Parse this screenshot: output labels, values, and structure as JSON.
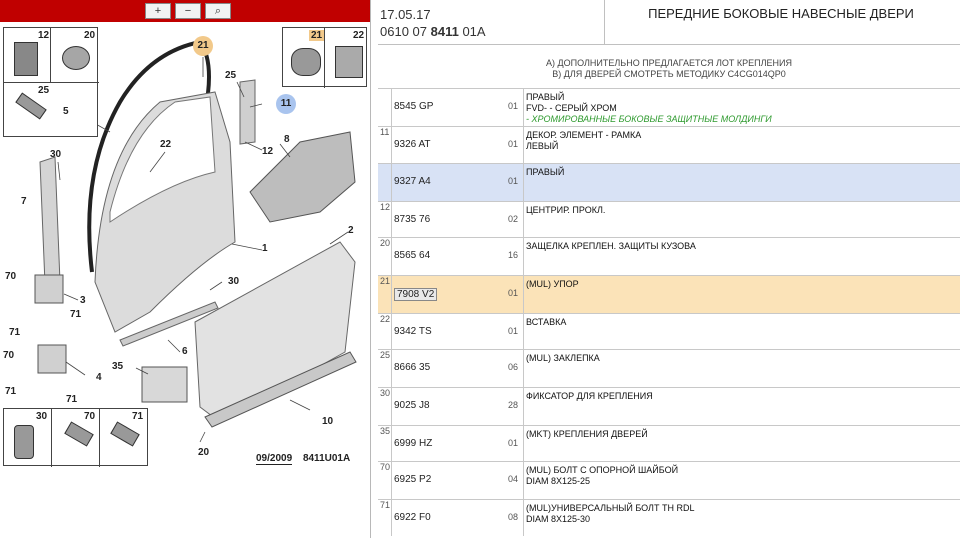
{
  "toolbar": {
    "zoom_in_label": "+",
    "zoom_out_label": "−",
    "zoom_fit_label": "⌕"
  },
  "header": {
    "date": "17.05.17",
    "code_prefix": "0610 07",
    "code_bold": "8411",
    "code_suffix": "01A",
    "title": "ПЕРЕДНИЕ БОКОВЫЕ НАВЕСНЫЕ ДВЕРИ"
  },
  "notes": {
    "line_a": "A) ДОПОЛНИТЕЛЬНО ПРЕДЛАГАЕТСЯ ЛОТ КРЕПЛЕНИЯ",
    "line_b": "B) ДЛЯ ДВЕРЕЙ СМОТРЕТЬ МЕТОДИКУ C4CG014QP0"
  },
  "diagram": {
    "stamp_date": "09/2009",
    "stamp_code": "8411U01A",
    "ref_top_left": [
      "12",
      "20",
      "25"
    ],
    "ref_top_right": [
      "21",
      "22"
    ],
    "ref_bottom": [
      "30",
      "70",
      "71"
    ],
    "callouts": [
      "5",
      "21",
      "25",
      "11",
      "12",
      "22",
      "30",
      "7",
      "8",
      "12",
      "1",
      "2",
      "70",
      "3",
      "71",
      "71",
      "30",
      "70",
      "4",
      "71",
      "71",
      "6",
      "35",
      "10",
      "20"
    ]
  },
  "parts": [
    {
      "ref": "",
      "part": "8545 GP",
      "qty": "01",
      "desc": [
        "ПРАВЫЙ",
        "FVD- - СЕРЫЙ ХРОМ"
      ],
      "note": "- ХРОМИРОВАННЫЕ БОКОВЫЕ ЗАЩИТНЫЕ МОЛДИНГИ",
      "highlight": "none"
    },
    {
      "ref": "11",
      "part": "9326 AT",
      "qty": "01",
      "desc": [
        "ДЕКОР. ЭЛЕМЕНТ - РАМКА",
        "ЛЕВЫЙ"
      ],
      "note": "",
      "highlight": "none"
    },
    {
      "ref": "",
      "part": "9327 A4",
      "qty": "01",
      "desc": [
        "ПРАВЫЙ"
      ],
      "note": "",
      "highlight": "blue"
    },
    {
      "ref": "12",
      "part": "8735 76",
      "qty": "02",
      "desc": [
        "ЦЕНТРИР. ПРОКЛ."
      ],
      "note": "",
      "highlight": "none"
    },
    {
      "ref": "20",
      "part": "8565 64",
      "qty": "16",
      "desc": [
        "ЗАЩЕЛКА КРЕПЛЕН. ЗАЩИТЫ КУЗОВА"
      ],
      "note": "",
      "highlight": "none"
    },
    {
      "ref": "21",
      "part": "7908 V2",
      "qty": "01",
      "desc": [
        "(MUL) УПОР"
      ],
      "note": "",
      "highlight": "orange"
    },
    {
      "ref": "22",
      "part": "9342 TS",
      "qty": "01",
      "desc": [
        "ВСТАВКА"
      ],
      "note": "",
      "highlight": "none"
    },
    {
      "ref": "25",
      "part": "8666 35",
      "qty": "06",
      "desc": [
        "(MUL) ЗАКЛЕПКА"
      ],
      "note": "",
      "highlight": "none"
    },
    {
      "ref": "30",
      "part": "9025 J8",
      "qty": "28",
      "desc": [
        "ФИКСАТОР ДЛЯ КРЕПЛЕНИЯ"
      ],
      "note": "",
      "highlight": "none"
    },
    {
      "ref": "35",
      "part": "6999 HZ",
      "qty": "01",
      "desc": [
        "(MKT) КРЕПЛЕНИЯ ДВЕРЕЙ"
      ],
      "note": "",
      "highlight": "none"
    },
    {
      "ref": "70",
      "part": "6925 P2",
      "qty": "04",
      "desc": [
        "(MUL) БОЛТ С ОПОРНОЙ ШАЙБОЙ",
        "DIAM 8X125-25"
      ],
      "note": "",
      "highlight": "none"
    },
    {
      "ref": "71",
      "part": "6922 F0",
      "qty": "08",
      "desc": [
        "(MUL)УНИВЕРСАЛЬНЫЙ БОЛТ TH RDL",
        "DIAM 8X125-30"
      ],
      "note": "",
      "highlight": "none"
    }
  ],
  "colors": {
    "toolbar_bg": "#c00000",
    "highlight_blue": "#d8e2f5",
    "highlight_orange": "#fbe3b8",
    "bubble_orange": "#f2c98a",
    "bubble_blue": "#a9c4ee",
    "note_green": "#2e9a2e"
  }
}
